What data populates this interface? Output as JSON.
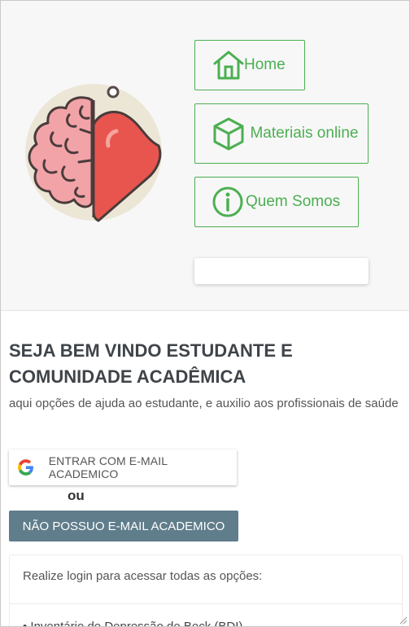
{
  "nav": {
    "home_label": "Home",
    "materiais_label": "Materiais online",
    "quem_somos_label": "Quem Somos",
    "accent_color": "#4caf50"
  },
  "welcome": {
    "title": "SEJA BEM VINDO ESTUDANTE E COMUNIDADE ACADÊMICA",
    "subtitle": "aqui opções de ajuda ao estudante, e auxilio aos profissionais de saúde"
  },
  "login": {
    "google_button_label": "ENTRAR COM E-MAIL ACADEMICO",
    "or_text": "ou",
    "no_email_button_label": "NÃO POSSUO E-MAIL ACADEMICO",
    "no_email_button_color": "#607d8b",
    "card_message": "Realize login para acessar todas as opções:",
    "list_item": "• Inventário de Depressão de Beck (BDI)"
  },
  "icons": {
    "logo": "brain-heart-logo",
    "home": "home-icon",
    "materiais": "cube-icon",
    "quem_somos": "info-icon",
    "google": "google-icon"
  }
}
